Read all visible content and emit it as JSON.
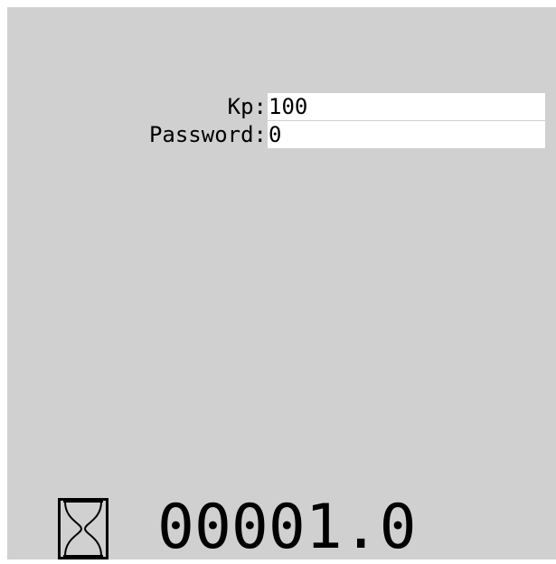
{
  "form": {
    "fields": [
      {
        "label": "Kp:",
        "value": "100"
      },
      {
        "label": "Password:",
        "value": "0"
      }
    ]
  },
  "status": {
    "icon": "hourglass-icon",
    "timer_value": "00001.0"
  }
}
